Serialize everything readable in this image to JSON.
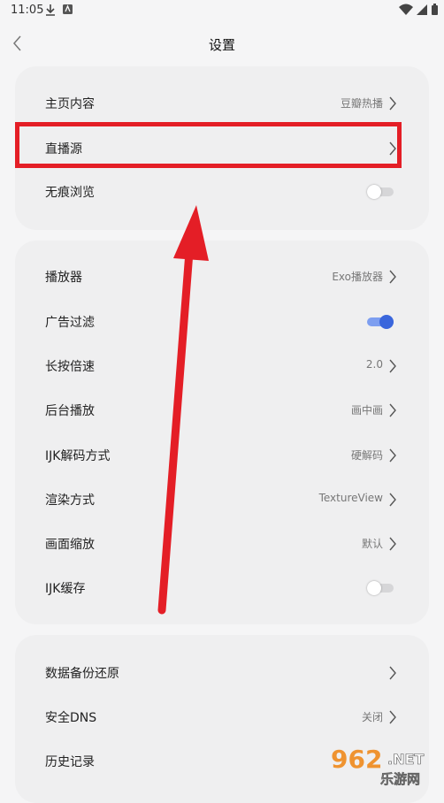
{
  "status_bar": {
    "time": "11:05"
  },
  "header": {
    "title": "设置"
  },
  "section1": [
    {
      "label": "主页内容",
      "value": "豆瓣热播",
      "control": "chevron"
    },
    {
      "label": "直播源",
      "value": "",
      "control": "chevron"
    },
    {
      "label": "无痕浏览",
      "value": "",
      "control": "toggle",
      "on": false
    }
  ],
  "section2": [
    {
      "label": "播放器",
      "value": "Exo播放器",
      "control": "chevron"
    },
    {
      "label": "广告过滤",
      "value": "",
      "control": "toggle",
      "on": true
    },
    {
      "label": "长按倍速",
      "value": "2.0",
      "control": "chevron"
    },
    {
      "label": "后台播放",
      "value": "画中画",
      "control": "chevron"
    },
    {
      "label": "IJK解码方式",
      "value": "硬解码",
      "control": "chevron"
    },
    {
      "label": "渲染方式",
      "value": "TextureView",
      "control": "chevron"
    },
    {
      "label": "画面缩放",
      "value": "默认",
      "control": "chevron"
    },
    {
      "label": "IJK缓存",
      "value": "",
      "control": "toggle",
      "on": false
    }
  ],
  "section3": [
    {
      "label": "数据备份还原",
      "value": "",
      "control": "chevron"
    },
    {
      "label": "安全DNS",
      "value": "关闭",
      "control": "chevron"
    },
    {
      "label": "历史记录",
      "value": "",
      "control": "none"
    }
  ],
  "colors": {
    "accent": "#3a66dc",
    "highlight": "#e41e26",
    "background": "#f5f5f6",
    "card": "#efeff0"
  },
  "watermark": {
    "text": "962.NET",
    "subtext": "乐游网"
  }
}
